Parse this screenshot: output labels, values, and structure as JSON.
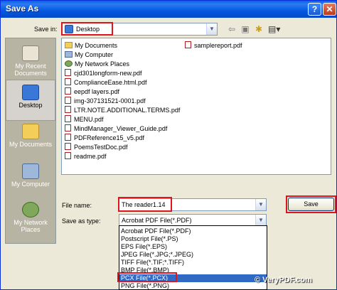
{
  "window": {
    "title": "Save As"
  },
  "save_in": {
    "label": "Save in:",
    "value": "Desktop"
  },
  "places": [
    {
      "label": "My Recent Documents"
    },
    {
      "label": "Desktop"
    },
    {
      "label": "My Documents"
    },
    {
      "label": "My Computer"
    },
    {
      "label": "My Network Places"
    }
  ],
  "files_col1": [
    {
      "name": "My Documents",
      "icon": "folder-icon"
    },
    {
      "name": "My Computer",
      "icon": "computer-icon"
    },
    {
      "name": "My Network Places",
      "icon": "network-icon"
    },
    {
      "name": "cjd301longform-new.pdf",
      "icon": "pdf-icon"
    },
    {
      "name": "ComplianceEase.html.pdf",
      "icon": "pdf-icon"
    },
    {
      "name": "eepdf layers.pdf",
      "icon": "pdf-icon"
    },
    {
      "name": "img-307131521-0001.pdf",
      "icon": "pdf-icon"
    },
    {
      "name": "LTR.NOTE.ADDITIONAL.TERMS.pdf",
      "icon": "pdf-icon"
    },
    {
      "name": "MENU.pdf",
      "icon": "pdf-icon"
    },
    {
      "name": "MindManager_Viewer_Guide.pdf",
      "icon": "pdf-icon"
    },
    {
      "name": "PDFReference15_v5.pdf",
      "icon": "pdf-icon"
    },
    {
      "name": "PoemsTestDoc.pdf",
      "icon": "pdf-icon"
    },
    {
      "name": "readme.pdf",
      "icon": "pdf-icon"
    }
  ],
  "files_col2": [
    {
      "name": "samplereport.pdf",
      "icon": "pdf-icon"
    }
  ],
  "file_name": {
    "label": "File name:",
    "value": "The reader1.14"
  },
  "save_as_type": {
    "label": "Save as type:",
    "value": "Acrobat PDF File(*.PDF)"
  },
  "type_options": [
    "Acrobat PDF File(*.PDF)",
    "Postscript File(*.PS)",
    "EPS File(*.EPS)",
    "JPEG File(*.JPG;*.JPEG)",
    "TIFF File(*.TIF;*.TIFF)",
    "BMP File(*.BMP)",
    "PCX File(*.PCX)",
    "PNG File(*.PNG)"
  ],
  "selected_type_index": 6,
  "buttons": {
    "save": "Save"
  },
  "watermark": "© VeryPDF.com",
  "colors": {
    "highlight": "#e0141c",
    "selection": "#316ac5"
  }
}
